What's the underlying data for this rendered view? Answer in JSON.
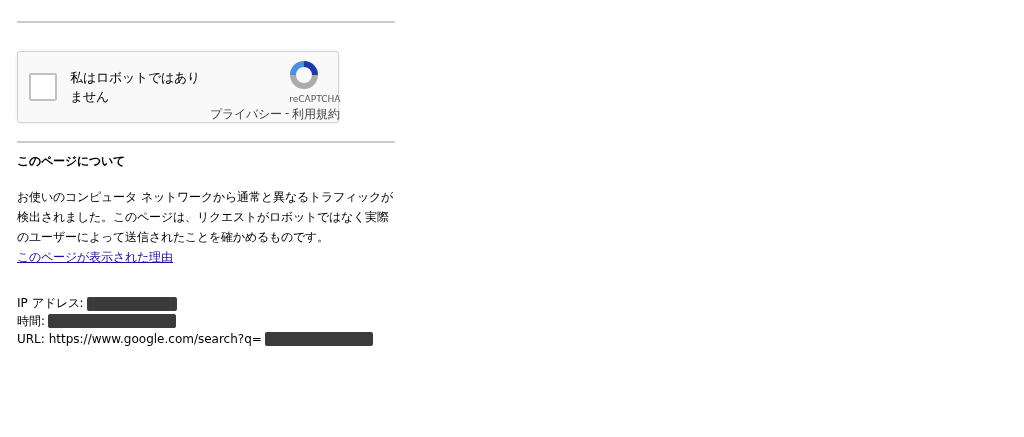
{
  "captcha": {
    "checked": false,
    "label": "私はロボットではありません",
    "brand": "reCAPTCHA",
    "privacy_link": "プライバシー",
    "separator": "-",
    "terms_link": "利用規約"
  },
  "about": {
    "heading": "このページについて",
    "paragraph": "お使いのコンピュータ ネットワークから通常と異なるトラフィックが検出されました。このページは、リクエストがロボットではなく実際のユーザーによって送信されたことを確かめるものです。",
    "link": "このページが表示された理由"
  },
  "details": [
    {
      "label": "IP アドレス:",
      "redacted": true
    },
    {
      "label": "時間:",
      "redacted": true
    },
    {
      "label": "URL: https://www.google.com/search?q=",
      "redacted": true
    }
  ]
}
